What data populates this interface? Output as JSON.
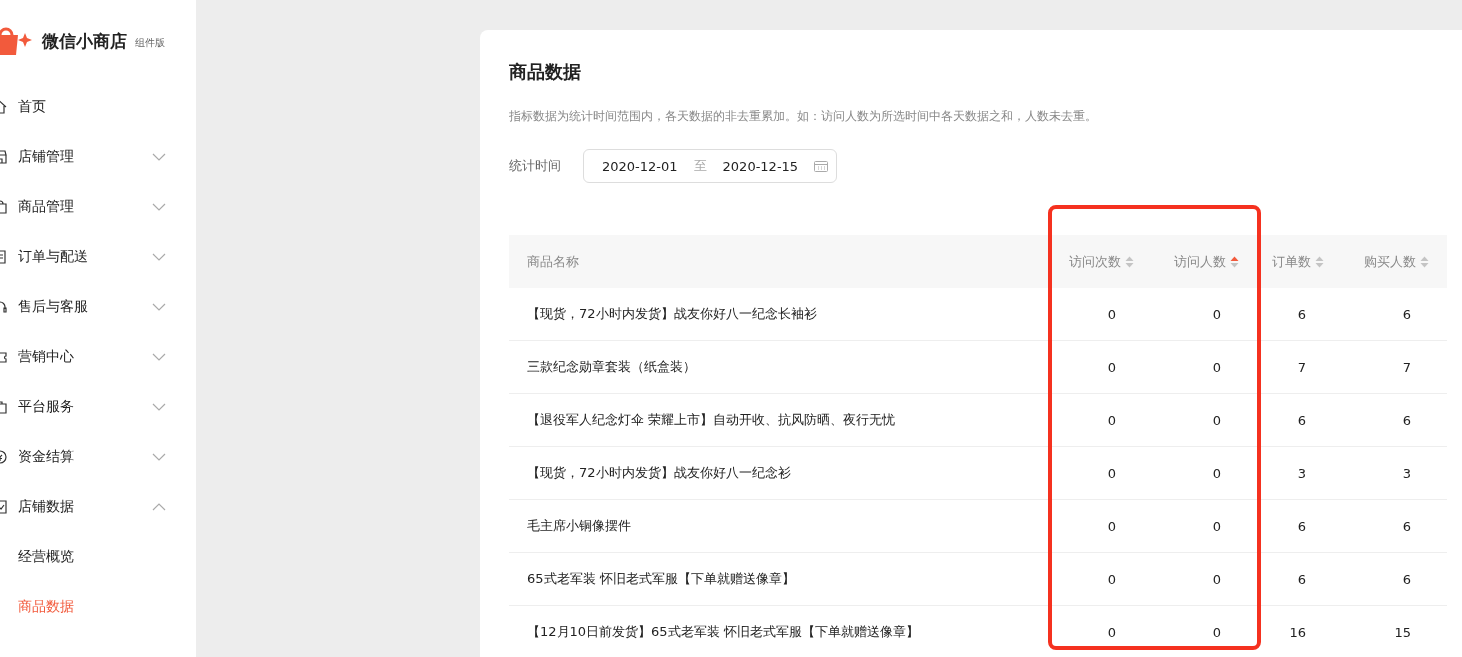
{
  "sidebar": {
    "brand": {
      "name": "微信小商店",
      "edition": "组件版"
    },
    "items": [
      {
        "label": "首页",
        "expandable": false,
        "expanded": false,
        "selected": false
      },
      {
        "label": "店铺管理",
        "expandable": true,
        "expanded": false,
        "selected": false
      },
      {
        "label": "商品管理",
        "expandable": true,
        "expanded": false,
        "selected": false
      },
      {
        "label": "订单与配送",
        "expandable": true,
        "expanded": false,
        "selected": false
      },
      {
        "label": "售后与客服",
        "expandable": true,
        "expanded": false,
        "selected": false
      },
      {
        "label": "营销中心",
        "expandable": true,
        "expanded": false,
        "selected": false
      },
      {
        "label": "平台服务",
        "expandable": true,
        "expanded": false,
        "selected": false
      },
      {
        "label": "资金结算",
        "expandable": true,
        "expanded": false,
        "selected": false
      },
      {
        "label": "店铺数据",
        "expandable": true,
        "expanded": true,
        "selected": false,
        "children": [
          {
            "label": "经营概览",
            "selected": false
          },
          {
            "label": "商品数据",
            "selected": true
          }
        ]
      }
    ]
  },
  "page": {
    "title": "商品数据",
    "note": "指标数据为统计时间范围内，各天数据的非去重累加。如：访问人数为所选时间中各天数据之和，人数未去重。",
    "date_filter": {
      "label": "统计时间",
      "start": "2020-12-01",
      "separator": "至",
      "end": "2020-12-15"
    }
  },
  "table": {
    "columns": [
      {
        "label": "商品名称",
        "sortable": false,
        "sorted_ascending": false
      },
      {
        "label": "访问次数",
        "sortable": true,
        "sorted_ascending": false
      },
      {
        "label": "访问人数",
        "sortable": true,
        "sorted_ascending": true
      },
      {
        "label": "订单数",
        "sortable": true,
        "sorted_ascending": false
      },
      {
        "label": "购买人数",
        "sortable": true,
        "sorted_ascending": false
      }
    ],
    "highlight_frame": true,
    "rows": [
      [
        "【现货，72小时内发货】战友你好八一纪念长袖衫",
        "0",
        "0",
        "6",
        "6"
      ],
      [
        "三款纪念勋章套装（纸盒装）",
        "0",
        "0",
        "7",
        "7"
      ],
      [
        "【退役军人纪念灯伞 荣耀上市】自动开收、抗风防晒、夜行无忧",
        "0",
        "0",
        "6",
        "6"
      ],
      [
        "【现货，72小时内发货】战友你好八一纪念衫",
        "0",
        "0",
        "3",
        "3"
      ],
      [
        "毛主席小铜像摆件",
        "0",
        "0",
        "6",
        "6"
      ],
      [
        "65式老军装 怀旧老式军服【下单就赠送像章】",
        "0",
        "0",
        "6",
        "6"
      ],
      [
        "【12月10日前发货】65式老军装 怀旧老式军服【下单就赠送像章】",
        "0",
        "0",
        "16",
        "15"
      ]
    ]
  }
}
